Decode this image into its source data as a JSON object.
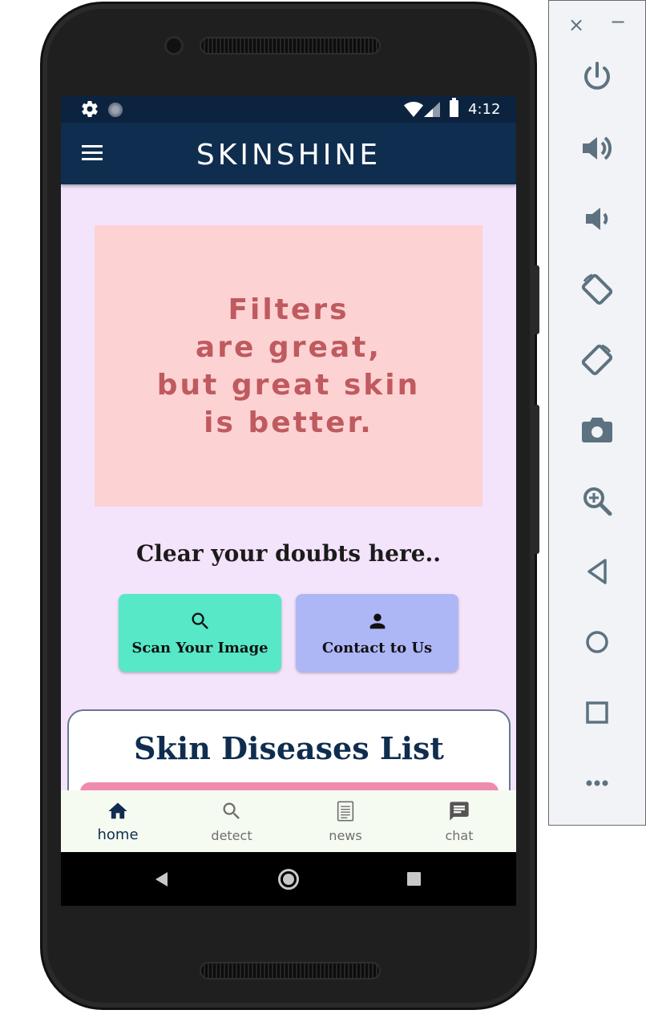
{
  "status_bar": {
    "time": "4:12",
    "icons": [
      "gear-icon",
      "sync-icon",
      "wifi-icon",
      "signal-icon",
      "battery-icon"
    ]
  },
  "app_bar": {
    "title": "SKINSHINE",
    "menu_icon": "hamburger-menu-icon",
    "color": "#0f2d4f"
  },
  "banner": {
    "text": "Filters\nare great,\nbut great skin\nis better.",
    "background": "#fdd2d3",
    "text_color": "#bf5a5f"
  },
  "doubts_heading": "Clear your doubts here..",
  "actions": [
    {
      "label": "Scan Your Image",
      "icon": "search-icon",
      "color": "#56e8c7"
    },
    {
      "label": "Contact to Us",
      "icon": "person-icon",
      "color": "#aeb7f6"
    }
  ],
  "disease_list": {
    "heading": "Skin Diseases List",
    "accent": "#f08bb0"
  },
  "bottom_nav": {
    "items": [
      {
        "label": "home",
        "icon": "home-icon",
        "active": true
      },
      {
        "label": "detect",
        "icon": "search-icon",
        "active": false
      },
      {
        "label": "news",
        "icon": "news-icon",
        "active": false
      },
      {
        "label": "chat",
        "icon": "chat-icon",
        "active": false
      }
    ]
  },
  "system_nav": {
    "icons": [
      "back-icon",
      "home-circle-icon",
      "recents-icon"
    ]
  },
  "emulator_toolbar": {
    "close": "×",
    "minimize": "−",
    "tools": [
      "power-icon",
      "volume-up-icon",
      "volume-down-icon",
      "rotate-left-icon",
      "rotate-right-icon",
      "camera-icon",
      "zoom-icon",
      "back-triangle-icon",
      "home-circle-icon",
      "overview-square-icon",
      "more-icon"
    ]
  }
}
